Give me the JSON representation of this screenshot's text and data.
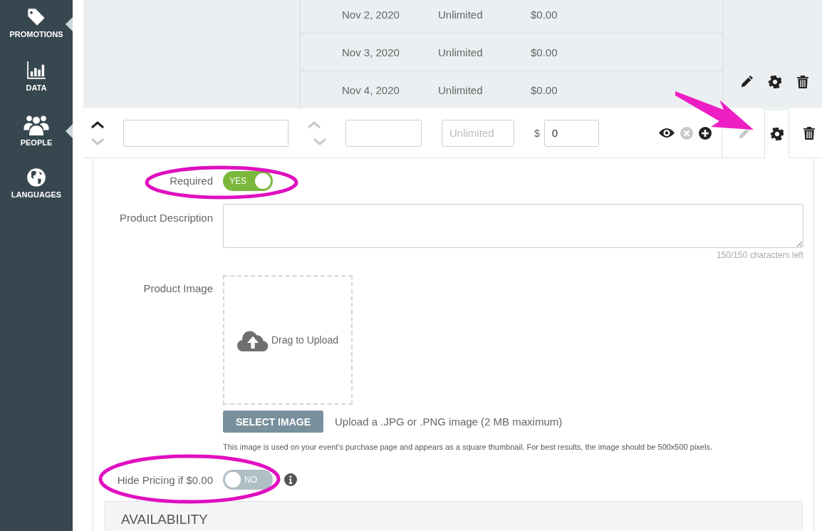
{
  "sidebar": {
    "items": [
      {
        "label": "PROMOTIONS",
        "expanded": true
      },
      {
        "label": "DATA",
        "expanded": false
      },
      {
        "label": "PEOPLE",
        "expanded": true
      },
      {
        "label": "LANGUAGES",
        "expanded": false
      }
    ]
  },
  "schedule_rows": [
    {
      "date": "Nov 2, 2020",
      "quantity": "Unlimited",
      "price": "$0.00"
    },
    {
      "date": "Nov 3, 2020",
      "quantity": "Unlimited",
      "price": "$0.00"
    },
    {
      "date": "Nov 4, 2020",
      "quantity": "Unlimited",
      "price": "$0.00"
    }
  ],
  "edit_row": {
    "quantity_placeholder": "Unlimited",
    "currency": "$",
    "price_value": "0",
    "settings_selected": true
  },
  "required": {
    "label": "Required",
    "on": true,
    "text": "YES"
  },
  "description": {
    "label": "Product Description",
    "counter": "150/150 characters left"
  },
  "image": {
    "label": "Product Image",
    "drop_text": "Drag to Upload",
    "button": "SELECT IMAGE",
    "hint": "Upload a .JPG or .PNG image (2 MB maximum)",
    "note": "This image is used on your event's purchase page and appears as a square thumbnail. For best results, the image should be 500x500 pixels."
  },
  "hide_pricing": {
    "label": "Hide Pricing if $0.00",
    "on": false,
    "text": "NO"
  },
  "section": {
    "title": "AVAILABILITY"
  }
}
